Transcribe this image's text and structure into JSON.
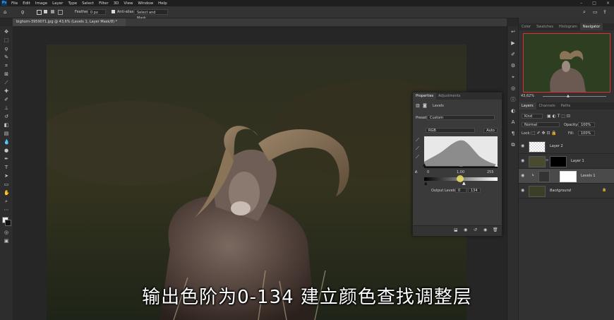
{
  "app": {
    "logo": "Ps"
  },
  "menu": [
    "File",
    "Edit",
    "Image",
    "Layer",
    "Type",
    "Select",
    "Filter",
    "3D",
    "View",
    "Window",
    "Help"
  ],
  "window_controls": [
    "–",
    "□",
    "×"
  ],
  "options_bar": {
    "feather_label": "Feather:",
    "feather_value": "0 px",
    "anti_alias_label": "Anti-alias",
    "select_mask_label": "Select and Mask..."
  },
  "document_tab": {
    "title": "bighorn-3959071.jpg @ 43,6% (Levels 1, Layer Mask/8) *"
  },
  "top_panel_tabs": [
    "Color",
    "Swatches",
    "Histogram",
    "Navigator"
  ],
  "navigator": {
    "zoom": "43,62%"
  },
  "layers_panel": {
    "tabs": [
      "Layers",
      "Channels",
      "Paths"
    ],
    "kind_label": "Kind",
    "blend_mode": "Normal",
    "opacity_label": "Opacity:",
    "opacity_value": "100%",
    "lock_label": "Lock:",
    "fill_label": "Fill:",
    "fill_value": "100%",
    "layers": [
      {
        "name": "Layer 2"
      },
      {
        "name": "Layer 1"
      },
      {
        "name": "Levels 1"
      },
      {
        "name": "Background"
      }
    ]
  },
  "properties": {
    "tabs": [
      "Properties",
      "Adjustments"
    ],
    "panel_title": "Levels",
    "preset_label": "Preset:",
    "preset_value": "Custom",
    "channel": "RGB",
    "auto_label": "Auto",
    "input_levels": [
      "0",
      "1,00",
      "255"
    ],
    "output_label": "Output Levels:",
    "output_values": [
      "0",
      "134"
    ]
  },
  "subtitle": "输出色阶为0-134 建立颜色查找调整层",
  "colors": {
    "accent_red": "#e03030",
    "highlight_yellow": "#f0e060"
  }
}
